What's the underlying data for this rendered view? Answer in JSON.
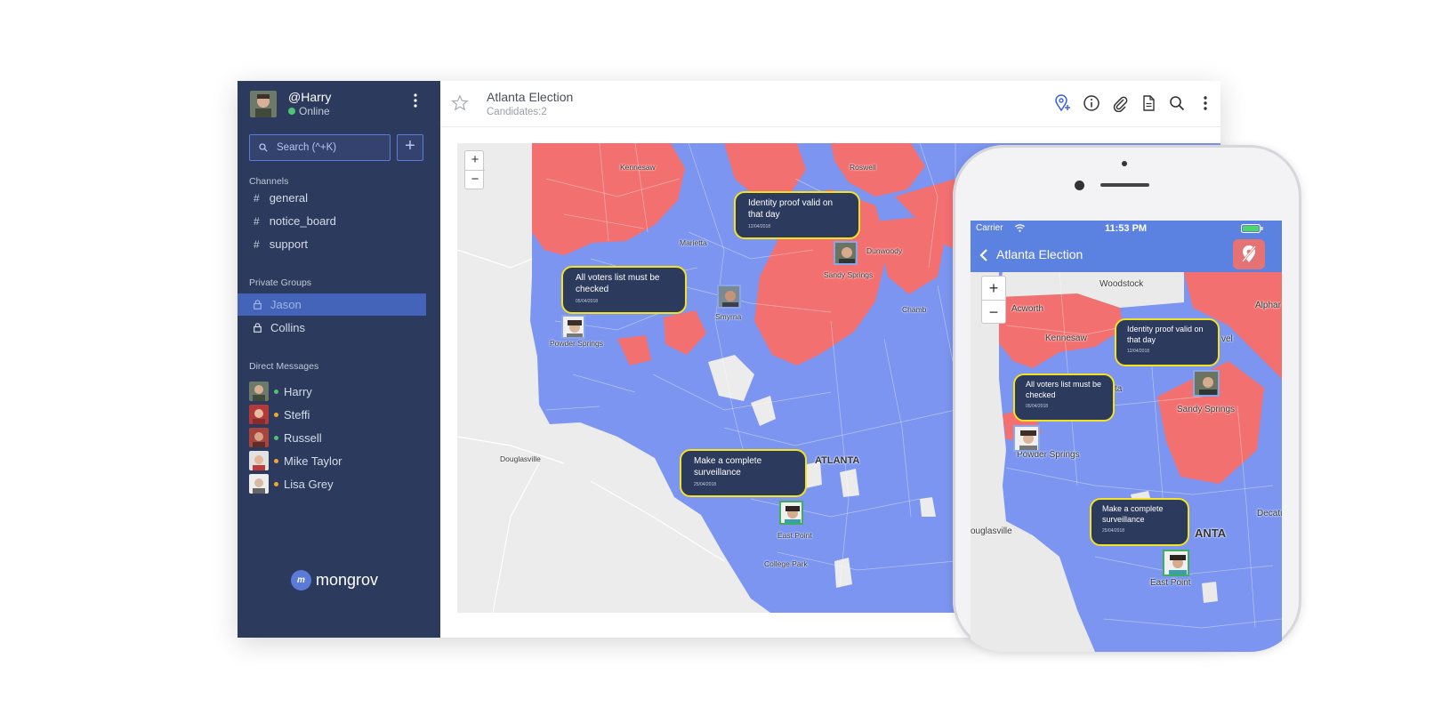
{
  "sidebar": {
    "user": {
      "name": "@Harry",
      "status": "Online"
    },
    "search": {
      "placeholder": "Search (^+K)"
    },
    "add_label": "+",
    "channels_title": "Channels",
    "channels": [
      {
        "label": "general"
      },
      {
        "label": "notice_board"
      },
      {
        "label": "support"
      }
    ],
    "groups_title": "Private Groups",
    "groups": [
      {
        "label": "Jason",
        "active": true
      },
      {
        "label": "Collins",
        "active": false
      }
    ],
    "dm_title": "Direct Messages",
    "direct_messages": [
      {
        "label": "Harry",
        "status_color": "#4fc36f"
      },
      {
        "label": "Steffi",
        "status_color": "#f0a92b"
      },
      {
        "label": "Russell",
        "status_color": "#4fc36f"
      },
      {
        "label": "Mike Taylor",
        "status_color": "#f0a92b"
      },
      {
        "label": "Lisa Grey",
        "status_color": "#f0a92b"
      }
    ],
    "brand": "mongrov",
    "brand_logo_text": "m"
  },
  "header": {
    "title": "Atlanta Election",
    "subtitle": "Candidates:2",
    "icons": [
      "add-location-icon",
      "info-icon",
      "attachment-icon",
      "document-icon",
      "search-icon",
      "more-icon"
    ]
  },
  "map": {
    "zoom_in": "+",
    "zoom_out": "−",
    "labels": {
      "kennesaw": "Kennesaw",
      "roswell": "Roswell",
      "marietta": "Marietta",
      "dunwoody": "Dunwoody",
      "sandy_springs": "Sandy Springs",
      "smyrna": "Smyrna",
      "powder_springs": "Powder Springs",
      "chamblee": "Chamb",
      "douglasville": "Douglasville",
      "atlanta": "ATLANTA",
      "east_point": "East Point",
      "college_park": "College Park"
    },
    "bubbles": [
      {
        "text": "Identity proof valid on that day",
        "date": "12/04/2018"
      },
      {
        "text": "All voters list must be checked",
        "date": "05/04/2018"
      },
      {
        "text": "Make a complete surveillance",
        "date": "25/04/2018"
      }
    ],
    "colors": {
      "red": "#f37070",
      "blue": "#7b95f0",
      "land": "#ececec"
    }
  },
  "phone": {
    "carrier": "Carrier",
    "time": "11:53 PM",
    "title": "Atlanta Election",
    "zoom_in": "+",
    "zoom_out": "−",
    "labels": {
      "woodstock": "Woodstock",
      "acworth": "Acworth",
      "alphar": "Alphar",
      "kennesaw": "Kennesaw",
      "sandy_springs": "Sandy Springs",
      "powder_springs": "Powder Springs",
      "douglasville": "ouglasville",
      "atlanta": "ANTA",
      "decatur": "Decatur",
      "east_point": "East Point",
      "roswell": "vel",
      "ta": "ta"
    },
    "bubbles": [
      {
        "text": "Identity proof valid on that day",
        "date": "12/04/2018"
      },
      {
        "text": "All voters list must be checked",
        "date": "05/04/2018"
      },
      {
        "text": "Make a complete surveillance",
        "date": "25/04/2018"
      }
    ]
  }
}
